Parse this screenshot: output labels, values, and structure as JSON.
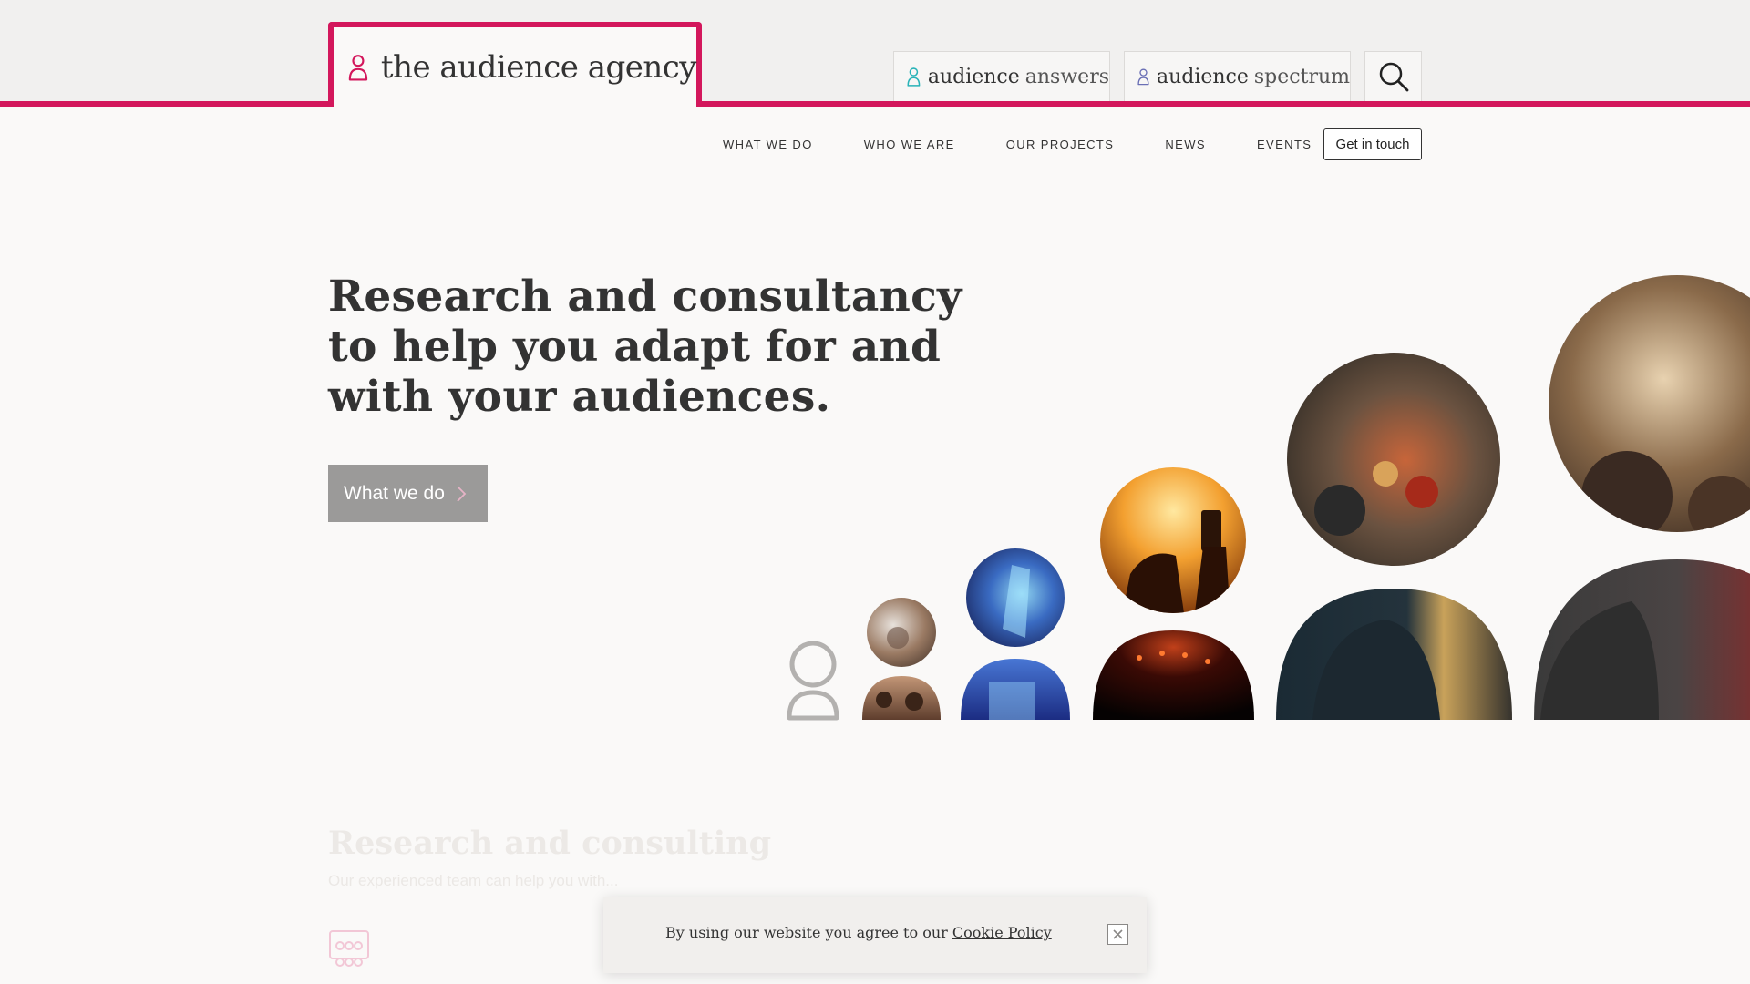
{
  "colors": {
    "brand": "#d3175c",
    "answers_accent": "#2ab3b8",
    "spectrum_accent": "#6a6fb5",
    "button_grey": "#9b9a99"
  },
  "header": {
    "logo_text": "the audience agency",
    "logo_icon": "person-icon",
    "products": [
      {
        "bold": "audience",
        "light": "answers",
        "icon": "person-icon"
      },
      {
        "bold": "audience",
        "light": "spectrum",
        "icon": "person-icon"
      }
    ],
    "search_icon": "search-icon"
  },
  "nav": {
    "items": [
      "WHAT WE DO",
      "WHO WE ARE",
      "OUR PROJECTS",
      "NEWS",
      "EVENTS"
    ],
    "cta_label": "Get in touch"
  },
  "hero": {
    "title": "Research and consultancy to help you adapt for and with your audiences.",
    "button_label": "What we do"
  },
  "section": {
    "title": "Research and consulting",
    "subtitle": "Our experienced team can help you with..."
  },
  "cookie": {
    "text": "By using our website you agree to our ",
    "link": "Cookie Policy",
    "close_icon": "close-icon"
  }
}
